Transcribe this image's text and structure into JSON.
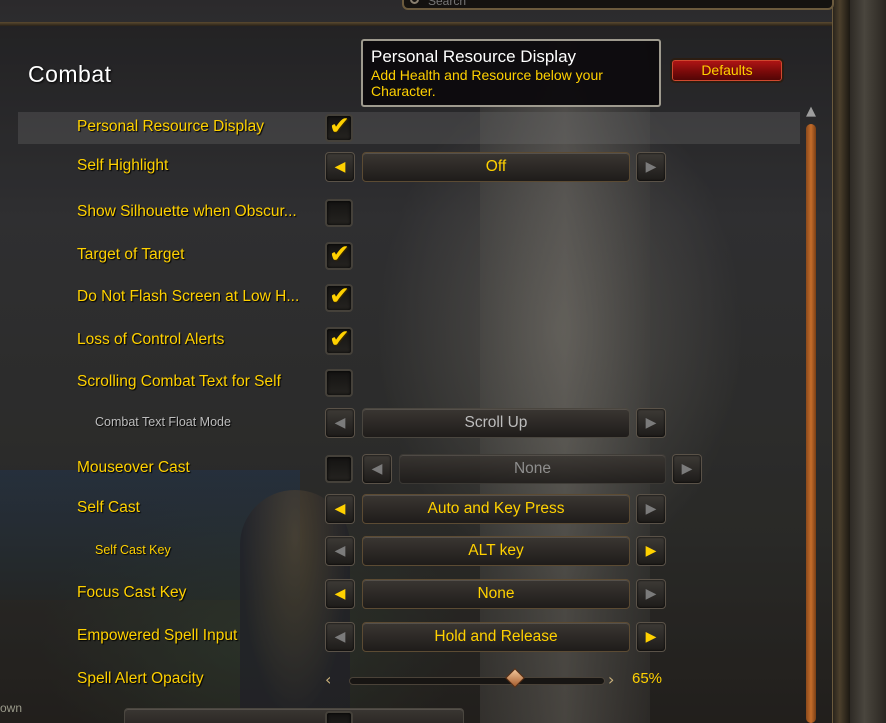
{
  "search": {
    "placeholder": "Search"
  },
  "page_title": "Combat",
  "defaults_label": "Defaults",
  "tooltip": {
    "title": "Personal Resource Display",
    "body": "Add Health and Resource below your Character."
  },
  "settings": [
    {
      "label": "Personal Resource Display",
      "checked": true
    },
    {
      "label": "Self Highlight",
      "value": "Off"
    },
    {
      "label": "Show Silhouette when Obscur...",
      "checked": false
    },
    {
      "label": "Target of Target",
      "checked": true
    },
    {
      "label": "Do Not Flash Screen at Low H...",
      "checked": true
    },
    {
      "label": "Loss of Control Alerts",
      "checked": true
    },
    {
      "label": "Scrolling Combat Text for Self",
      "checked": false
    },
    {
      "label": "Combat Text Float Mode",
      "value": "Scroll Up"
    },
    {
      "label": "Mouseover Cast",
      "checked": false,
      "value": "None"
    },
    {
      "label": "Self Cast",
      "value": "Auto and Key Press"
    },
    {
      "label": "Self Cast Key",
      "value": "ALT key"
    },
    {
      "label": "Focus Cast Key",
      "value": "None"
    },
    {
      "label": "Empowered Spell Input",
      "value": "Hold and Release"
    },
    {
      "label": "Spell Alert Opacity",
      "value": "65%",
      "level": 0.65
    }
  ],
  "corner_text": "own",
  "icons": {
    "check": "✔",
    "left": "◀",
    "right": "▶",
    "slider_left": "‹",
    "slider_right": "›",
    "scroll_up": "▲"
  }
}
